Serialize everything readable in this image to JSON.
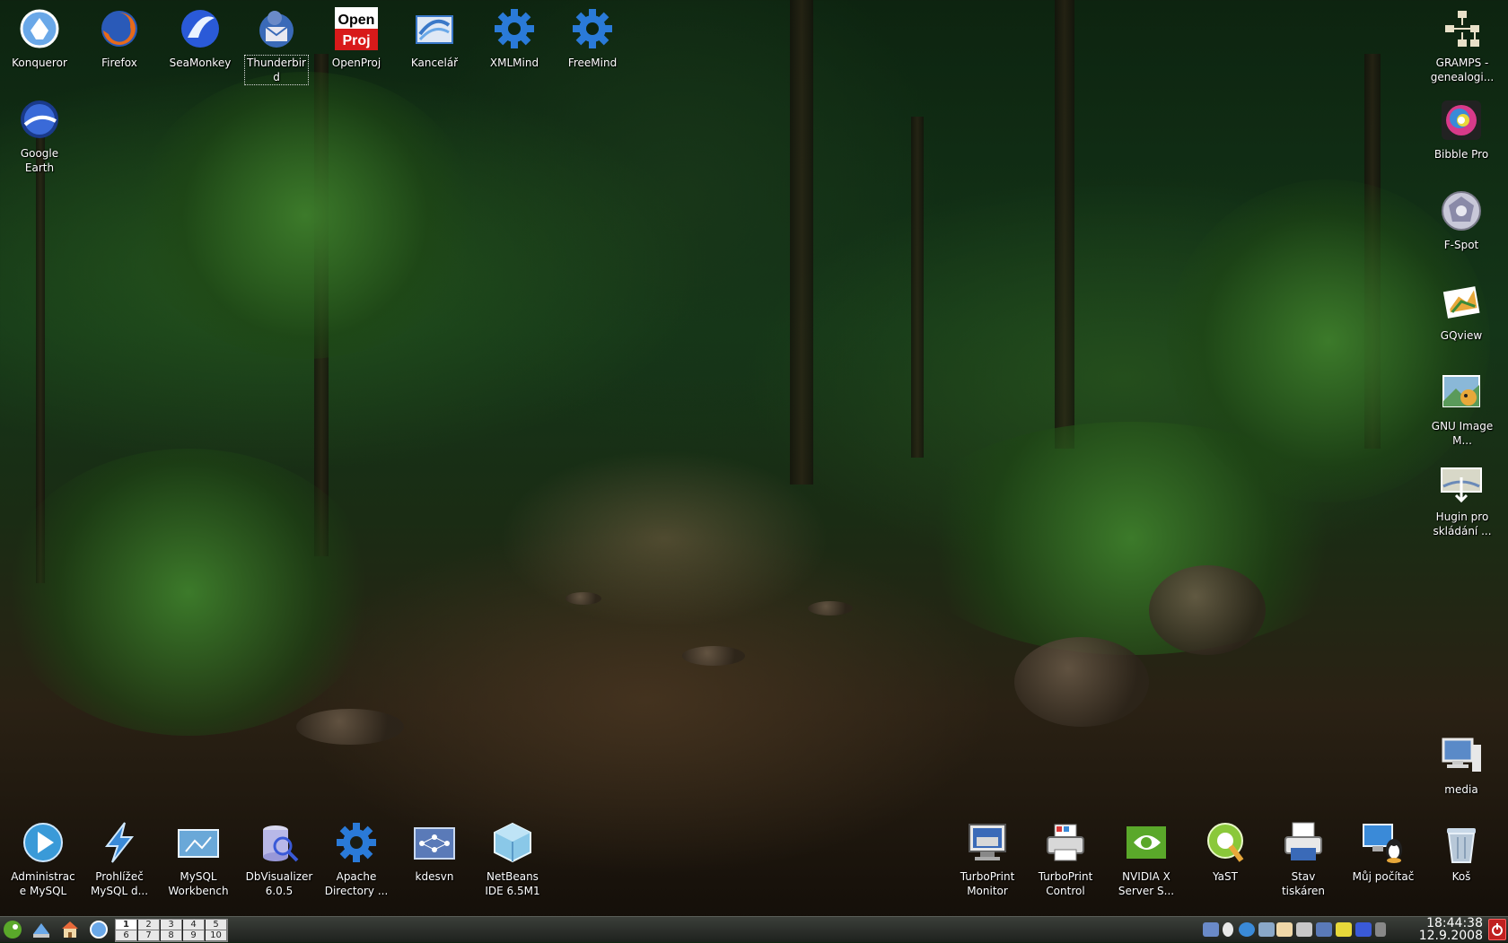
{
  "desktop": {
    "top_icons": [
      {
        "label": "Konqueror",
        "icon": "konqueror-icon",
        "color": "#6aa8e8"
      },
      {
        "label": "Firefox",
        "icon": "firefox-icon",
        "color": "#e86a1a"
      },
      {
        "label": "SeaMonkey",
        "icon": "seamonkey-icon",
        "color": "#2a5ad8"
      },
      {
        "label": "Thunderbird",
        "icon": "thunderbird-icon",
        "color": "#3a6ab8"
      },
      {
        "label": "OpenProj",
        "icon": "openproj-icon",
        "color": "#d81a1a"
      },
      {
        "label": "Kancelář",
        "icon": "office-icon",
        "color": "#3a78c8"
      },
      {
        "label": "XMLMind",
        "icon": "gear-icon",
        "color": "#2a7ad8"
      },
      {
        "label": "FreeMind",
        "icon": "gear-icon",
        "color": "#2a7ad8"
      }
    ],
    "google_earth": {
      "label": "Google Earth",
      "icon": "google-earth-icon",
      "color": "#2a5ab8"
    },
    "right_icons": [
      {
        "label": "GRAMPS - genealogi...",
        "icon": "gramps-icon",
        "color": "#e8e0c8"
      },
      {
        "label": "Bibble Pro",
        "icon": "bibble-icon",
        "color": "#d83a8a"
      },
      {
        "label": "F-Spot",
        "icon": "fspot-icon",
        "color": "#c8c8d8"
      },
      {
        "label": "GQview",
        "icon": "gqview-icon",
        "color": "#e8a83a"
      },
      {
        "label": "GNU Image M...",
        "icon": "gimp-icon",
        "color": "#8ab8d8"
      },
      {
        "label": "Hugin pro skládání ...",
        "icon": "hugin-icon",
        "color": "#d8d8c8"
      },
      {
        "label": "media",
        "icon": "computer-icon",
        "color": "#a8c8e8"
      }
    ],
    "bottom_left_icons": [
      {
        "label": "Administrace MySQL",
        "icon": "play-icon",
        "color": "#3a9ad8"
      },
      {
        "label": "Prohlížeč MySQL d...",
        "icon": "lightning-icon",
        "color": "#3a8ad8"
      },
      {
        "label": "MySQL Workbench",
        "icon": "workbench-icon",
        "color": "#6aa8d8"
      },
      {
        "label": "DbVisualizer 6.0.5",
        "icon": "dbvisualizer-icon",
        "color": "#b8b8e8"
      },
      {
        "label": "Apache Directory ...",
        "icon": "gear-icon",
        "color": "#2a7ad8"
      },
      {
        "label": "kdesvn",
        "icon": "kdesvn-icon",
        "color": "#5a7ab8"
      },
      {
        "label": "NetBeans IDE 6.5M1",
        "icon": "netbeans-icon",
        "color": "#8ac8e8"
      }
    ],
    "bottom_right_icons": [
      {
        "label": "TurboPrint Monitor",
        "icon": "printer-monitor-icon",
        "color": "#d8d8d8"
      },
      {
        "label": "TurboPrint Control",
        "icon": "printer-icon",
        "color": "#d8d8d8"
      },
      {
        "label": "NVIDIA X Server S...",
        "icon": "nvidia-icon",
        "color": "#5aa82a"
      },
      {
        "label": "YaST",
        "icon": "yast-icon",
        "color": "#8ac83a"
      },
      {
        "label": "Stav tiskáren",
        "icon": "printer-status-icon",
        "color": "#e8e8e8"
      },
      {
        "label": "Můj počítač",
        "icon": "my-computer-icon",
        "color": "#3a8ad8"
      },
      {
        "label": "Koš",
        "icon": "trash-icon",
        "color": "#b8c8d8"
      }
    ]
  },
  "taskbar": {
    "pager": [
      "1",
      "2",
      "3",
      "4",
      "5",
      "6",
      "7",
      "8",
      "9",
      "10"
    ],
    "clock": {
      "time": "18:44:38",
      "date": "12.9.2008"
    }
  }
}
